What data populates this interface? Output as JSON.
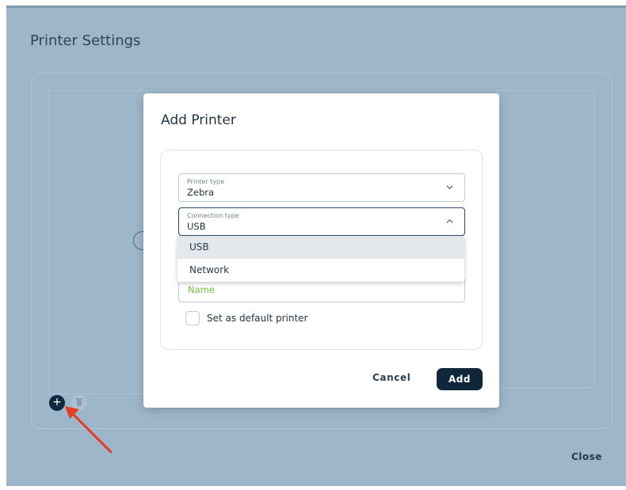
{
  "page": {
    "title": "Printer Settings",
    "close_label": "Close"
  },
  "toolbar": {
    "add_icon_glyph": "+",
    "add_icon": "plus-icon",
    "delete_icon": "trash-icon"
  },
  "dialog": {
    "title": "Add Printer",
    "printer_type": {
      "label": "Printer type",
      "value": "Zebra"
    },
    "connection_type": {
      "label": "Connection type",
      "value": "USB",
      "options": [
        "USB",
        "Network"
      ],
      "selected_index": 0
    },
    "name_field": {
      "placeholder": "Name"
    },
    "default_checkbox": {
      "label": "Set as default printer",
      "checked": false
    },
    "cancel_label": "Cancel",
    "add_label": "Add"
  },
  "colors": {
    "backdrop": "#9db6c9",
    "primary_button": "#10263a",
    "placeholder_green": "#6cbf3a",
    "annotation_arrow": "#e63b24"
  }
}
